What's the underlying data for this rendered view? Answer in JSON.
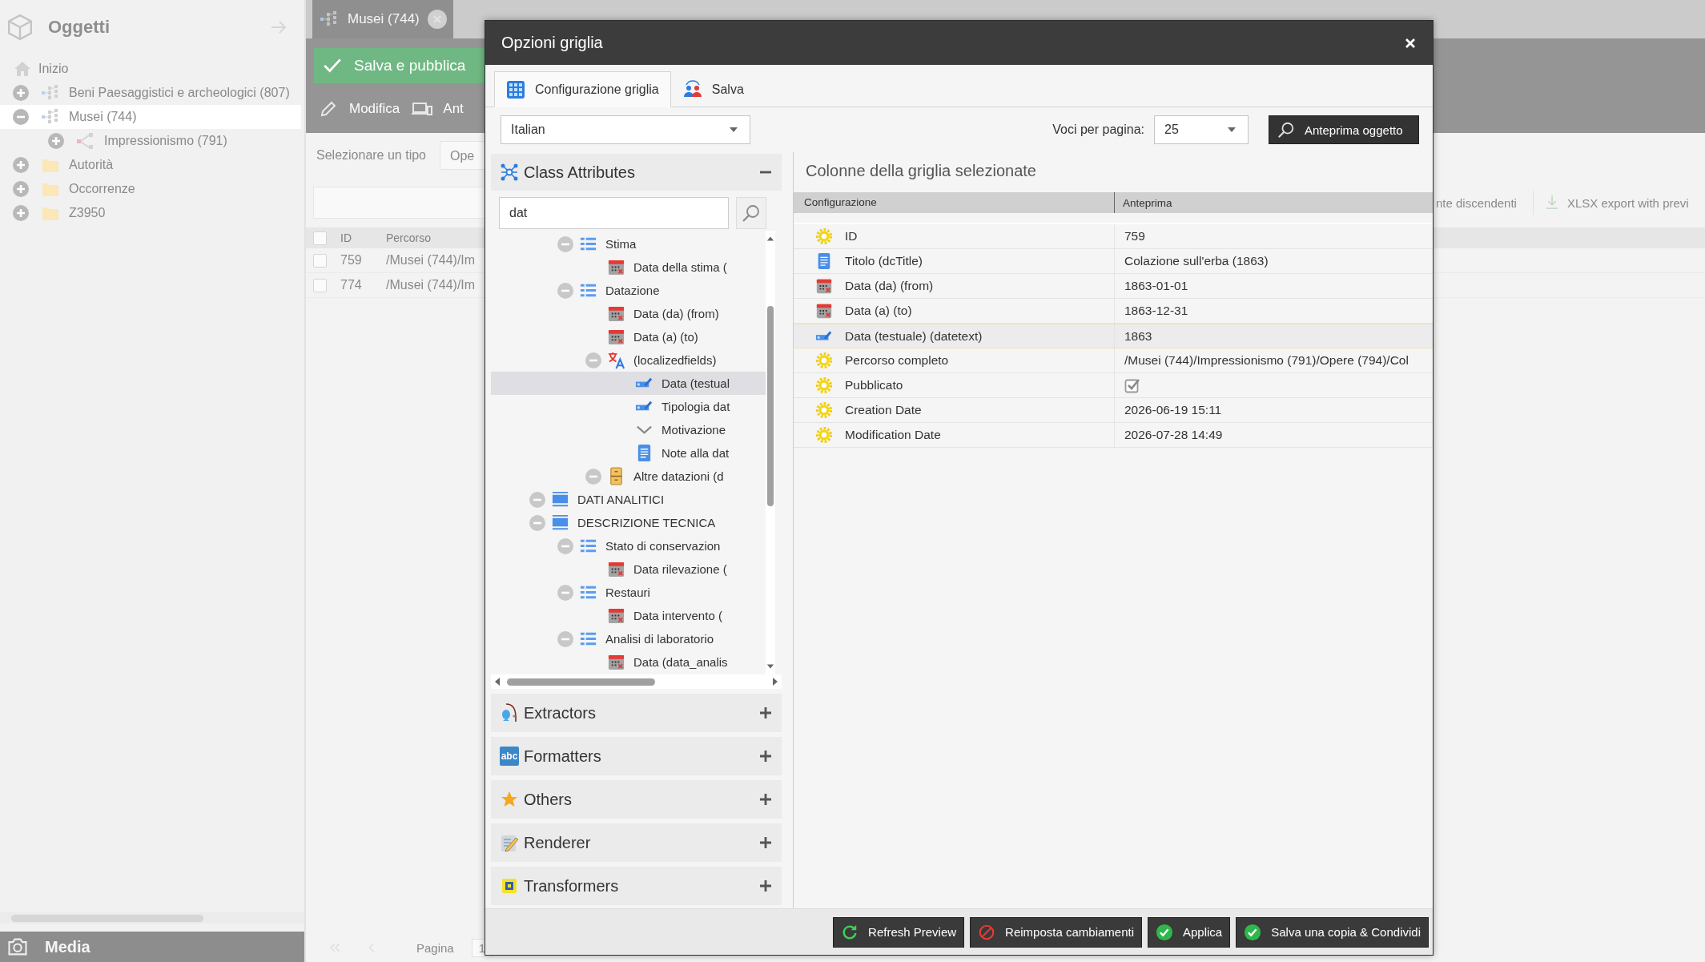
{
  "sidebar": {
    "title": "Oggetti",
    "items": [
      {
        "label": "Inizio",
        "kind": "home",
        "selected": false
      },
      {
        "label": "Beni Paesaggistici e archeologici (807)",
        "kind": "object",
        "expanded": false,
        "selected": false
      },
      {
        "label": "Musei (744)",
        "kind": "object",
        "expanded": true,
        "selected": true,
        "children": [
          {
            "label": "Impressionismo (791)",
            "kind": "variant",
            "expanded": false,
            "selected": false
          }
        ]
      },
      {
        "label": "Autorità",
        "kind": "folder",
        "expanded": false,
        "selected": false
      },
      {
        "label": "Occorrenze",
        "kind": "folder",
        "expanded": false,
        "selected": false
      },
      {
        "label": "Z3950",
        "kind": "folder",
        "expanded": false,
        "selected": false
      }
    ],
    "bottom_panel": "Media"
  },
  "editor_tab": {
    "label": "Musei (744)"
  },
  "toolbar": {
    "primary_button": "Salva e pubblica",
    "tools": [
      "Modifica",
      "Ant"
    ]
  },
  "filter": {
    "label": "Selezionare un tipo",
    "select_value": "Ope"
  },
  "actions_right": [
    "nte discendenti",
    "XLSX export with previ"
  ],
  "grid": {
    "all_checked": false,
    "columns": [
      "ID",
      "Percorso"
    ],
    "rows": [
      {
        "id": "759",
        "path": "/Musei (744)/Im",
        "checked": false
      },
      {
        "id": "774",
        "path": "/Musei (744)/Im",
        "checked": false
      }
    ]
  },
  "pagination": {
    "label": "Pagina",
    "page": "1"
  },
  "dialog": {
    "title": "Opzioni griglia",
    "tabs": [
      {
        "label": "Configurazione griglia",
        "kind": "grid",
        "selected": true
      },
      {
        "label": "Salva",
        "kind": "share",
        "selected": false
      }
    ],
    "language": "Italian",
    "per_page_label": "Voci per pagina:",
    "per_page": "25",
    "preview_button": "Anteprima oggetto",
    "search": "dat",
    "panels": [
      {
        "title": "Class Attributes",
        "kind": "attributes",
        "expanded": true
      },
      {
        "title": "Extractors",
        "kind": "extractors",
        "expanded": false
      },
      {
        "title": "Formatters",
        "kind": "formatters",
        "icon_text": "abc",
        "expanded": false
      },
      {
        "title": "Others",
        "kind": "others",
        "expanded": false
      },
      {
        "title": "Renderer",
        "kind": "renderer",
        "expanded": false
      },
      {
        "title": "Transformers",
        "kind": "transformers",
        "expanded": false
      }
    ],
    "tree": [
      {
        "children": [
          {
            "label": "Stima",
            "kind": "collection",
            "expanded": true,
            "selected": false,
            "children": [
              {
                "label": "Data della stima (",
                "kind": "date",
                "selected": false
              }
            ]
          },
          {
            "label": "Datazione",
            "kind": "collection",
            "expanded": true,
            "selected": false,
            "children": [
              {
                "label": "Data (da) (from)",
                "kind": "date",
                "selected": false
              },
              {
                "label": "Data (a) (to)",
                "kind": "date",
                "selected": false
              },
              {
                "label": "(localizedfields)",
                "kind": "localized",
                "expanded": true,
                "selected": false,
                "children": [
                  {
                    "label": "Data (testual",
                    "kind": "input",
                    "selected": true
                  },
                  {
                    "label": "Tipologia dat",
                    "kind": "input",
                    "selected": false
                  },
                  {
                    "label": "Motivazione",
                    "kind": "select",
                    "selected": false
                  },
                  {
                    "label": "Note alla dat",
                    "kind": "textarea",
                    "selected": false
                  }
                ]
              },
              {
                "label": "Altre datazioni (d",
                "kind": "bricks",
                "expanded": true,
                "selected": false
              }
            ]
          }
        ]
      },
      {
        "label": "DATI ANALITICI",
        "kind": "panel",
        "expanded": true,
        "selected": false
      },
      {
        "label": "DESCRIZIONE TECNICA",
        "kind": "panel",
        "expanded": true,
        "selected": false,
        "children": [
          {
            "label": "Stato di conservazion",
            "kind": "collection",
            "expanded": true,
            "selected": false,
            "children": [
              {
                "label": "Data rilevazione (",
                "kind": "date",
                "selected": false
              }
            ]
          },
          {
            "label": "Restauri",
            "kind": "collection",
            "expanded": true,
            "selected": false,
            "children": [
              {
                "label": "Data intervento (",
                "kind": "date",
                "selected": false
              }
            ]
          },
          {
            "label": "Analisi di laboratorio",
            "kind": "collection",
            "expanded": true,
            "selected": false,
            "children": [
              {
                "label": "Data (data_analis",
                "kind": "date",
                "selected": false
              }
            ]
          }
        ]
      }
    ],
    "columns_title": "Colonne della griglia selezionate",
    "table": {
      "columns": [
        "Configurazione",
        "Anteprima"
      ],
      "rows": [
        {
          "label": "ID",
          "kind": "system",
          "value": "759",
          "selected": false
        },
        {
          "label": "Titolo (dcTitle)",
          "kind": "textarea",
          "value": "Colazione sull'erba (1863)",
          "selected": false
        },
        {
          "label": "Data (da) (from)",
          "kind": "date",
          "value": "1863-01-01",
          "selected": false
        },
        {
          "label": "Data (a) (to)",
          "kind": "date",
          "value": "1863-12-31",
          "selected": false
        },
        {
          "label": "Data (testuale) (datetext)",
          "kind": "input",
          "value": "1863",
          "selected": true
        },
        {
          "label": "Percorso completo",
          "kind": "system",
          "value": "/Musei (744)/Impressionismo (791)/Opere (794)/Col",
          "selected": false
        },
        {
          "label": "Pubblicato",
          "kind": "system",
          "checked": true,
          "selected": false
        },
        {
          "label": "Creation Date",
          "kind": "system",
          "value": "2026-06-19 15:11",
          "selected": false
        },
        {
          "label": "Modification Date",
          "kind": "system",
          "value": "2026-07-28 14:49",
          "selected": false
        }
      ]
    },
    "buttons": [
      {
        "label": "Refresh Preview",
        "kind": "refresh"
      },
      {
        "label": "Reimposta cambiamenti",
        "kind": "reset"
      },
      {
        "label": "Applica",
        "kind": "apply"
      },
      {
        "label": "Salva una copia & Condividi",
        "kind": "apply"
      }
    ]
  }
}
